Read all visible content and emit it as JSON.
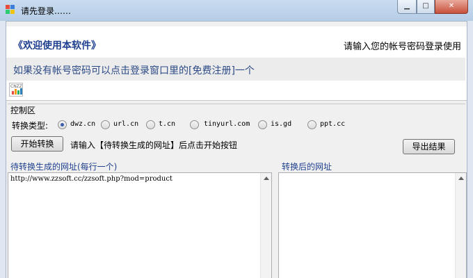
{
  "window": {
    "title": "请先登录……"
  },
  "header": {
    "welcome": "《欢迎使用本软件》",
    "prompt": "请输入您的帐号密码登录使用",
    "info": "如果没有帐号密码可以点击登录窗口里的[免费注册]一个",
    "logo_text": "CNZZ"
  },
  "control": {
    "group_label": "控制区",
    "type_label": "转换类型:",
    "options": [
      {
        "label": "dwz.cn",
        "selected": true
      },
      {
        "label": "url.cn",
        "selected": false
      },
      {
        "label": "t.cn",
        "selected": false
      },
      {
        "label": "tinyurl.com",
        "selected": false
      },
      {
        "label": "is.gd",
        "selected": false
      },
      {
        "label": "ppt.cc",
        "selected": false
      }
    ],
    "start_button": "开始转换",
    "hint": "请输入【待转换生成的网址】后点击开始按钮",
    "export_button": "导出结果"
  },
  "left_panel": {
    "label": "待转换生成的网址(每行一个)",
    "value": "http://www.zzsoft.cc/zzsoft.php?mod=product"
  },
  "right_panel": {
    "label": "转换后的网址",
    "value": ""
  },
  "colors": {
    "accent": "#1f3f8f",
    "info_text": "#2c4a86",
    "selected_dot": "#3b5fab"
  }
}
